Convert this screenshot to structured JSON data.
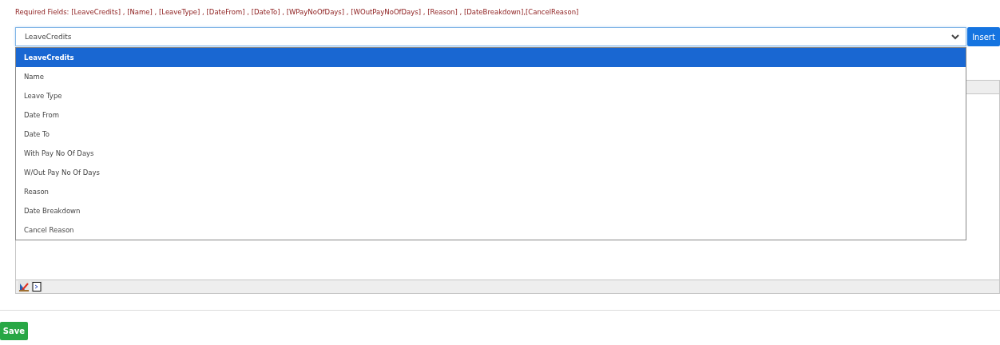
{
  "required_fields": "Required Fields: [LeaveCredits] , [Name] , [LeaveType] , [DateFrom] , [DateTo] , [WPayNoOfDays] , [WOutPayNoOfDays] , [Reason] , [DateBreakdown],[CancelReason]",
  "field_select": {
    "value": "LeaveCredits",
    "expanded": true,
    "options": [
      {
        "label": "LeaveCredits",
        "selected": true
      },
      {
        "label": "Name",
        "selected": false
      },
      {
        "label": "Leave Type",
        "selected": false
      },
      {
        "label": "Date From",
        "selected": false
      },
      {
        "label": "Date To",
        "selected": false
      },
      {
        "label": "With Pay No Of Days",
        "selected": false
      },
      {
        "label": "W/Out Pay No Of Days",
        "selected": false
      },
      {
        "label": "Reason",
        "selected": false
      },
      {
        "label": "Date Breakdown",
        "selected": false
      },
      {
        "label": "Cancel Reason",
        "selected": false
      }
    ]
  },
  "insert_button": "Insert",
  "save_button": "Save"
}
